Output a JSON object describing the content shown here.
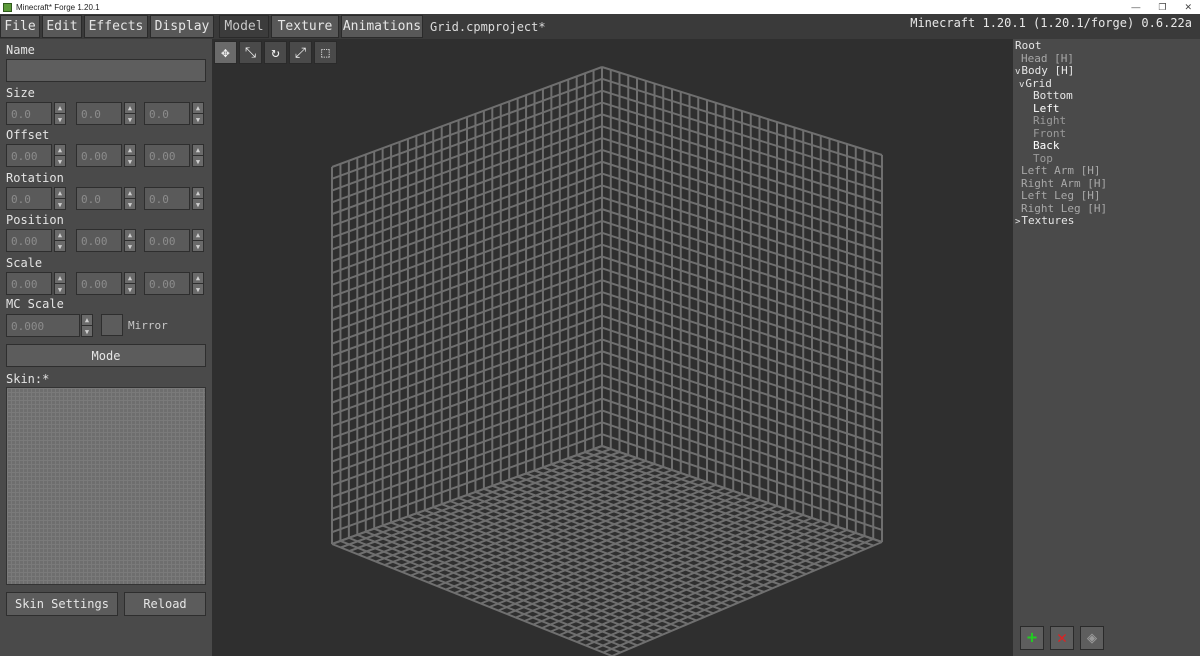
{
  "window": {
    "title": "Minecraft* Forge 1.20.1",
    "controls": [
      "—",
      "❐",
      "✕"
    ]
  },
  "menubar": {
    "items": [
      {
        "name": "menu-file",
        "label": "File"
      },
      {
        "name": "menu-edit",
        "label": "Edit"
      },
      {
        "name": "menu-effects",
        "label": "Effects"
      },
      {
        "name": "menu-display",
        "label": "Display"
      }
    ],
    "tabs": [
      {
        "name": "tab-model",
        "label": "Model",
        "active": true
      },
      {
        "name": "tab-texture",
        "label": "Texture",
        "active": false
      },
      {
        "name": "tab-animations",
        "label": "Animations",
        "active": false
      }
    ],
    "project_title": "Grid.cpmproject*",
    "version": "Minecraft 1.20.1 (1.20.1/forge) 0.6.22a"
  },
  "left_panel": {
    "name_label": "Name",
    "name_value": "",
    "fields": [
      {
        "key": "size",
        "label": "Size",
        "values": [
          "0.0",
          "0.0",
          "0.0"
        ]
      },
      {
        "key": "offset",
        "label": "Offset",
        "values": [
          "0.00",
          "0.00",
          "0.00"
        ]
      },
      {
        "key": "rotation",
        "label": "Rotation",
        "values": [
          "0.0",
          "0.0",
          "0.0"
        ]
      },
      {
        "key": "position",
        "label": "Position",
        "values": [
          "0.00",
          "0.00",
          "0.00"
        ]
      },
      {
        "key": "scale",
        "label": "Scale",
        "values": [
          "0.00",
          "0.00",
          "0.00"
        ]
      }
    ],
    "mc_scale_label": "MC Scale",
    "mc_scale_value": "0.000",
    "mirror_label": "Mirror",
    "mode_button": "Mode",
    "skin_label": "Skin:*",
    "skin_settings_button": "Skin Settings",
    "reload_button": "Reload"
  },
  "toolbar": {
    "tools": [
      {
        "name": "move-tool-icon",
        "glyph": "✥",
        "active": true
      },
      {
        "name": "resize-tool-icon",
        "glyph": "⤡",
        "active": false
      },
      {
        "name": "rotate-tool-icon",
        "glyph": "↻",
        "active": false
      },
      {
        "name": "size-tool-icon",
        "glyph": "⤢",
        "active": false
      },
      {
        "name": "offset-tool-icon",
        "glyph": "⬚",
        "active": false
      }
    ]
  },
  "tree": {
    "items": [
      {
        "name": "tree-root",
        "label": "Root",
        "prefix": "",
        "color": "#e6e6e6"
      },
      {
        "name": "tree-head",
        "label": "Head [H]",
        "prefix": "",
        "color": "#a8a8a8"
      },
      {
        "name": "tree-body",
        "label": "Body [H]",
        "prefix": "v",
        "color": "#e6e6e6"
      },
      {
        "name": "tree-grid",
        "label": "Grid",
        "prefix": "v",
        "color": "#e6e6e6"
      },
      {
        "name": "tree-bottom",
        "label": "Bottom",
        "prefix": "",
        "color": "#e6e6e6"
      },
      {
        "name": "tree-left",
        "label": "Left",
        "prefix": "",
        "color": "#ffffff"
      },
      {
        "name": "tree-right",
        "label": "Right",
        "prefix": "",
        "color": "#9a9a9a"
      },
      {
        "name": "tree-front",
        "label": "Front",
        "prefix": "",
        "color": "#9a9a9a"
      },
      {
        "name": "tree-back",
        "label": "Back",
        "prefix": "",
        "color": "#ffffff"
      },
      {
        "name": "tree-top",
        "label": "Top",
        "prefix": "",
        "color": "#9a9a9a"
      },
      {
        "name": "tree-left-arm",
        "label": "Left Arm [H]",
        "prefix": "",
        "color": "#a8a8a8"
      },
      {
        "name": "tree-right-arm",
        "label": "Right Arm [H]",
        "prefix": "",
        "color": "#a8a8a8"
      },
      {
        "name": "tree-left-leg",
        "label": "Left Leg [H]",
        "prefix": "",
        "color": "#a8a8a8"
      },
      {
        "name": "tree-right-leg",
        "label": "Right Leg [H]",
        "prefix": "",
        "color": "#a8a8a8"
      },
      {
        "name": "tree-textures",
        "label": "Textures",
        "prefix": ">",
        "color": "#e6e6e6"
      }
    ],
    "buttons": [
      {
        "name": "add-element-button",
        "icon": "plus-icon",
        "glyph": "+",
        "color": "#22cc22"
      },
      {
        "name": "delete-element-button",
        "icon": "x-icon",
        "glyph": "✕",
        "color": "#dd2222"
      },
      {
        "name": "layers-button",
        "icon": "layers-icon",
        "glyph": "◈",
        "color": "#9a9a9a"
      }
    ]
  },
  "colors": {
    "grid_line": "#6f6f6f",
    "viewport_bg": "#2f2f2f"
  }
}
